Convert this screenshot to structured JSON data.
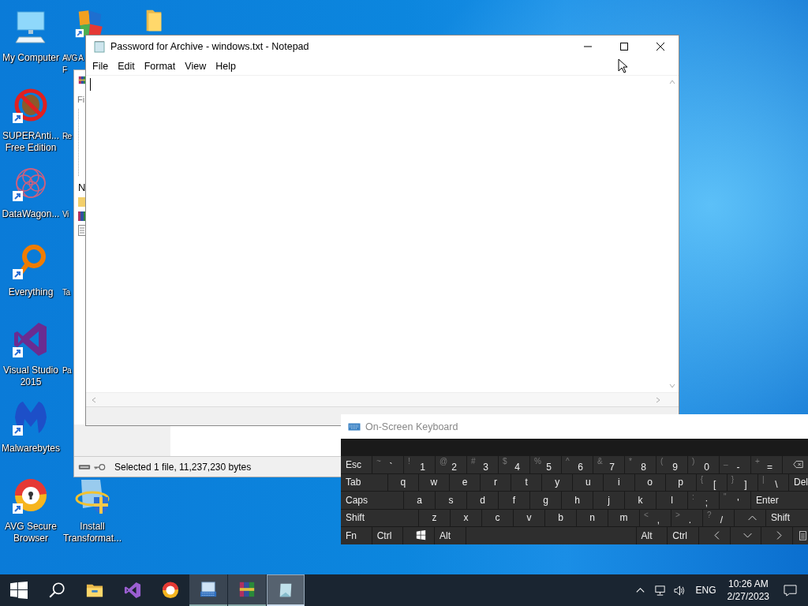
{
  "desktop": {
    "rows": [
      {
        "icons": [
          {
            "kind": "computer",
            "lines": [
              "My Computer"
            ],
            "shortcut": false,
            "clipped": false
          },
          {
            "kind": "avg",
            "lines": [
              "AVG A",
              "F"
            ],
            "shortcut": true,
            "clipped": true
          },
          {
            "kind": "folder",
            "shortcut": false,
            "clipped": false
          }
        ]
      },
      {
        "icons": [
          {
            "kind": "superanti",
            "lines": [
              "SUPERAnti...",
              "Free Edition"
            ],
            "shortcut": true,
            "clipped": false
          },
          {
            "lines": [
              "Re"
            ],
            "clipped": true
          }
        ]
      },
      {
        "icons": [
          {
            "kind": "datawagon",
            "lines": [
              "DataWagon..."
            ],
            "shortcut": true,
            "clipped": false
          },
          {
            "lines": [
              "Vi"
            ],
            "clipped": true
          }
        ]
      },
      {
        "icons": [
          {
            "kind": "everything",
            "lines": [
              "Everything"
            ],
            "shortcut": true,
            "clipped": false
          },
          {
            "lines": [
              "Ta"
            ],
            "clipped": true
          }
        ]
      },
      {
        "icons": [
          {
            "kind": "vs",
            "lines": [
              "Visual Studio",
              "2015"
            ],
            "shortcut": true,
            "clipped": false
          },
          {
            "lines": [
              "Pa"
            ],
            "clipped": true
          }
        ]
      },
      {
        "icons": [
          {
            "kind": "malwarebytes",
            "lines": [
              "Malwarebytes"
            ],
            "shortcut": true,
            "clipped": false
          }
        ]
      },
      {
        "icons": [
          {
            "kind": "avg-browser",
            "lines": [
              "AVG Secure",
              "Browser"
            ],
            "shortcut": true,
            "clipped": false
          },
          {
            "kind": "installer",
            "lines": [
              "Install",
              "Transformat..."
            ],
            "shortcut": false,
            "clipped": false
          }
        ]
      }
    ]
  },
  "archive_window": {
    "menu_item": "Fi",
    "column_header": "N",
    "status": "Selected 1 file, 11,237,230 bytes"
  },
  "notepad": {
    "title": "Password for Archive - windows.txt - Notepad",
    "menu": [
      "File",
      "Edit",
      "Format",
      "View",
      "Help"
    ]
  },
  "keyboard": {
    "title": "On-Screen Keyboard",
    "rows": [
      [
        {
          "kind": "label",
          "main": "Esc"
        },
        {
          "kind": "dual",
          "shift": "~",
          "main": "`"
        },
        {
          "kind": "dual",
          "shift": "!",
          "main": "1"
        },
        {
          "kind": "dual",
          "shift": "@",
          "main": "2"
        },
        {
          "kind": "dual",
          "shift": "#",
          "main": "3"
        },
        {
          "kind": "dual",
          "shift": "$",
          "main": "4"
        },
        {
          "kind": "dual",
          "shift": "%",
          "main": "5"
        },
        {
          "kind": "dual",
          "shift": "^",
          "main": "6"
        },
        {
          "kind": "dual",
          "shift": "&",
          "main": "7"
        },
        {
          "kind": "dual",
          "shift": "*",
          "main": "8"
        },
        {
          "kind": "dual",
          "shift": "(",
          "main": "9"
        },
        {
          "kind": "dual",
          "shift": ")",
          "main": "0"
        },
        {
          "kind": "dual",
          "shift": "_",
          "main": "-"
        },
        {
          "kind": "dual",
          "shift": "+",
          "main": "="
        },
        {
          "kind": "backspace"
        }
      ],
      [
        {
          "kind": "label",
          "main": "Tab"
        },
        {
          "kind": "char",
          "main": "q"
        },
        {
          "kind": "char",
          "main": "w"
        },
        {
          "kind": "char",
          "main": "e"
        },
        {
          "kind": "char",
          "main": "r"
        },
        {
          "kind": "char",
          "main": "t"
        },
        {
          "kind": "char",
          "main": "y"
        },
        {
          "kind": "char",
          "main": "u"
        },
        {
          "kind": "char",
          "main": "i"
        },
        {
          "kind": "char",
          "main": "o"
        },
        {
          "kind": "char",
          "main": "p"
        },
        {
          "kind": "dual",
          "shift": "{",
          "main": "["
        },
        {
          "kind": "dual",
          "shift": "}",
          "main": "]"
        },
        {
          "kind": "dual",
          "shift": "|",
          "main": "\\"
        },
        {
          "kind": "label",
          "main": "Del"
        }
      ],
      [
        {
          "kind": "label",
          "main": "Caps"
        },
        {
          "kind": "char",
          "main": "a"
        },
        {
          "kind": "char",
          "main": "s"
        },
        {
          "kind": "char",
          "main": "d"
        },
        {
          "kind": "char",
          "main": "f"
        },
        {
          "kind": "char",
          "main": "g"
        },
        {
          "kind": "char",
          "main": "h"
        },
        {
          "kind": "char",
          "main": "j"
        },
        {
          "kind": "char",
          "main": "k"
        },
        {
          "kind": "char",
          "main": "l"
        },
        {
          "kind": "dual",
          "shift": ":",
          "main": ";"
        },
        {
          "kind": "dual",
          "shift": "\"",
          "main": "'"
        },
        {
          "kind": "label",
          "main": "Enter"
        }
      ],
      [
        {
          "kind": "label",
          "main": "Shift"
        },
        {
          "kind": "char",
          "main": "z"
        },
        {
          "kind": "char",
          "main": "x"
        },
        {
          "kind": "char",
          "main": "c"
        },
        {
          "kind": "char",
          "main": "v"
        },
        {
          "kind": "char",
          "main": "b"
        },
        {
          "kind": "char",
          "main": "n"
        },
        {
          "kind": "char",
          "main": "m"
        },
        {
          "kind": "dual",
          "shift": "<",
          "main": ","
        },
        {
          "kind": "dual",
          "shift": ">",
          "main": "."
        },
        {
          "kind": "dual",
          "shift": "?",
          "main": "/"
        },
        {
          "kind": "up"
        },
        {
          "kind": "label",
          "main": "Shift"
        }
      ],
      [
        {
          "kind": "label",
          "main": "Fn"
        },
        {
          "kind": "label",
          "main": "Ctrl"
        },
        {
          "kind": "windows"
        },
        {
          "kind": "label",
          "main": "Alt"
        },
        {
          "kind": "space"
        },
        {
          "kind": "label",
          "main": "Alt"
        },
        {
          "kind": "label",
          "main": "Ctrl"
        },
        {
          "kind": "left"
        },
        {
          "kind": "down"
        },
        {
          "kind": "right"
        },
        {
          "kind": "options"
        }
      ]
    ]
  },
  "taskbar": {
    "apps": [
      {
        "kind": "explorer",
        "open": false,
        "selected": false
      },
      {
        "kind": "vs",
        "open": false,
        "selected": false
      },
      {
        "kind": "avg-browser",
        "open": false,
        "selected": false
      },
      {
        "kind": "keyboard",
        "open": true,
        "selected": false
      },
      {
        "kind": "winrar",
        "open": true,
        "selected": false
      },
      {
        "kind": "notepad",
        "open": true,
        "selected": true
      }
    ],
    "language": "ENG",
    "time": "10:26 AM",
    "date": "2/27/2023"
  }
}
